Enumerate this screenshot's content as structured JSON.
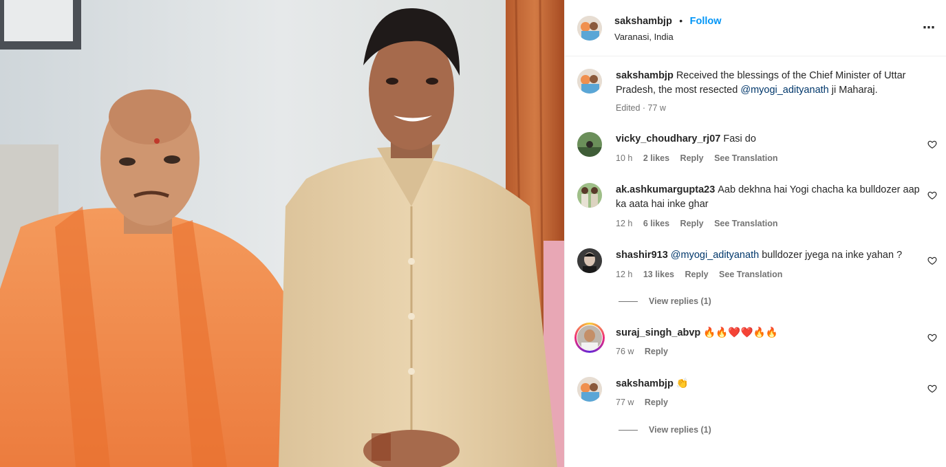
{
  "post": {
    "author": "sakshambjp",
    "follow_label": "Follow",
    "separator": "•",
    "location": "Varanasi, India",
    "more_icon": "more-options-icon",
    "caption_author": "sakshambjp",
    "caption_text_1": "Received the blessings of the Chief Minister of Uttar Pradesh, the most resected ",
    "caption_mention": "@myogi_adityanath",
    "caption_text_2": " ji Maharaj.",
    "caption_meta": "Edited · 77 w"
  },
  "comments": [
    {
      "user": "vicky_choudhary_rj07",
      "text": "Fasi do",
      "time": "10 h",
      "likes": "2 likes",
      "reply": "Reply",
      "translate": "See Translation"
    },
    {
      "user": "ak.ashkumargupta23",
      "text": "Aab dekhna hai Yogi chacha ka bulldozer aap ka aata hai inke ghar",
      "time": "12 h",
      "likes": "6 likes",
      "reply": "Reply",
      "translate": "See Translation"
    },
    {
      "user": "shashir913",
      "mention": "@myogi_adityanath",
      "text": " bulldozer jyega na inke yahan ?",
      "time": "12 h",
      "likes": "13 likes",
      "reply": "Reply",
      "translate": "See Translation",
      "view_replies": "View replies (1)"
    },
    {
      "user": "suraj_singh_abvp",
      "text": "🔥🔥❤️❤️🔥🔥",
      "time": "76 w",
      "reply": "Reply"
    },
    {
      "user": "sakshambjp",
      "text": "👏",
      "time": "77 w",
      "reply": "Reply",
      "view_replies": "View replies (1)"
    }
  ],
  "colors": {
    "accent": "#0095f6",
    "mention": "#00376b",
    "muted": "#737373",
    "saffron": "#f08a4b",
    "shirt": "#e6cfa6"
  }
}
